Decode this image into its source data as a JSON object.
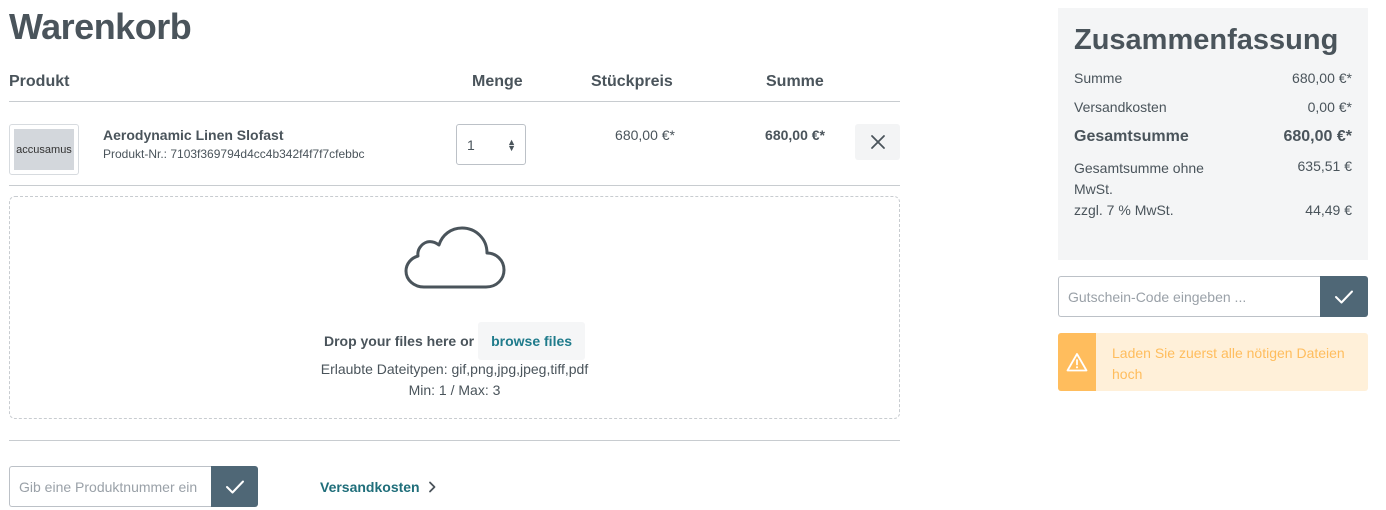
{
  "page": {
    "title": "Warenkorb"
  },
  "cart": {
    "headers": {
      "product": "Produkt",
      "quantity": "Menge",
      "unit_price": "Stückpreis",
      "total": "Summe"
    },
    "items": [
      {
        "thumb_text": "accusamus",
        "name": "Aerodynamic Linen Slofast",
        "product_number": "Produkt-Nr.: 7103f369794d4cc4b342f4f7f7cfebbc",
        "quantity": "1",
        "unit_price": "680,00 €*",
        "total": "680,00 €*"
      }
    ]
  },
  "upload": {
    "drop_text": "Drop your files here or",
    "browse_label": "browse files",
    "allowed_types": "Erlaubte Dateitypen: gif,png,jpg,jpeg,tiff,pdf",
    "min_max": "Min: 1 / Max: 3"
  },
  "product_number_input": {
    "placeholder": "Gib eine Produktnummer ein"
  },
  "shipping_link": {
    "label": "Versandkosten"
  },
  "summary": {
    "title": "Zusammenfassung",
    "subtotal_label": "Summe",
    "subtotal_value": "680,00 €*",
    "shipping_label": "Versandkosten",
    "shipping_value": "0,00 €*",
    "grand_total_label": "Gesamtsumme",
    "grand_total_value": "680,00 €*",
    "net_label": "Gesamtsumme ohne MwSt.",
    "net_value": "635,51 €",
    "tax_label": "zzgl. 7 % MwSt.",
    "tax_value": "44,49 €"
  },
  "voucher": {
    "placeholder": "Gutschein-Code eingeben ..."
  },
  "alert": {
    "text": "Laden Sie zuerst alle nötigen Dateien hoch"
  },
  "colors": {
    "accent": "#4f6776",
    "link": "#1f7b8b",
    "warning": "#ffbd5d",
    "warning_bg": "#fff0d9",
    "summary_bg": "#f4f5f6"
  }
}
